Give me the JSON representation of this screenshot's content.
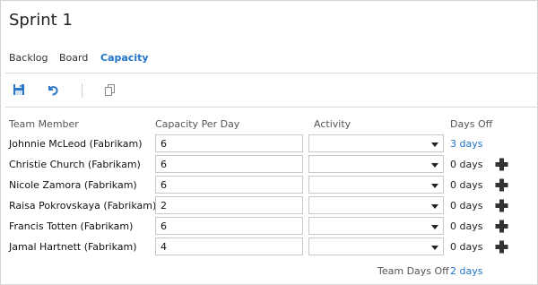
{
  "page": {
    "title": "Sprint 1"
  },
  "tabs": [
    {
      "label": "Backlog",
      "active": false
    },
    {
      "label": "Board",
      "active": false
    },
    {
      "label": "Capacity",
      "active": true
    }
  ],
  "toolbar": {
    "save_icon": "save-icon",
    "undo_icon": "undo-icon",
    "copy_icon": "copy-icon"
  },
  "table": {
    "headers": {
      "member": "Team Member",
      "capacity": "Capacity Per Day",
      "activity": "Activity",
      "days_off": "Days Off"
    },
    "rows": [
      {
        "member": "Johnnie McLeod (Fabrikam)",
        "capacity": "6",
        "activity": "",
        "days_off": "3 days",
        "days_off_is_link": true
      },
      {
        "member": "Christie Church (Fabrikam)",
        "capacity": "6",
        "activity": "",
        "days_off": "0 days",
        "days_off_is_link": false
      },
      {
        "member": "Nicole Zamora (Fabrikam)",
        "capacity": "6",
        "activity": "",
        "days_off": "0 days",
        "days_off_is_link": false
      },
      {
        "member": "Raisa Pokrovskaya (Fabrikam)",
        "capacity": "2",
        "activity": "",
        "days_off": "0 days",
        "days_off_is_link": false
      },
      {
        "member": "Francis Totten (Fabrikam)",
        "capacity": "6",
        "activity": "",
        "days_off": "0 days",
        "days_off_is_link": false
      },
      {
        "member": "Jamal Hartnett (Fabrikam)",
        "capacity": "4",
        "activity": "",
        "days_off": "0 days",
        "days_off_is_link": false
      }
    ]
  },
  "footer": {
    "team_days_off_label": "Team Days Off",
    "team_days_off_value": "2 days"
  },
  "colors": {
    "accent": "#1f73c8",
    "border": "#c8c8c8",
    "divider": "#d9d9d9"
  }
}
